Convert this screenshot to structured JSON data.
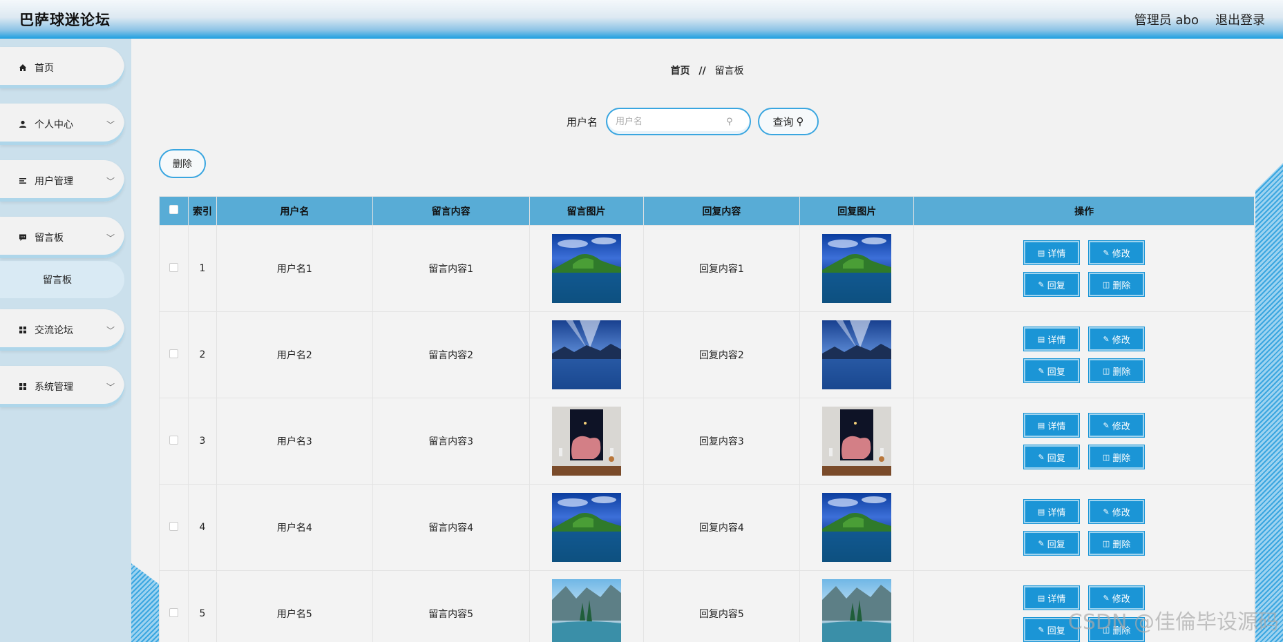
{
  "header": {
    "title": "巴萨球迷论坛",
    "user": "管理员 abo",
    "logout": "退出登录"
  },
  "sidebar": {
    "items": [
      {
        "label": "首页",
        "icon": "home-icon"
      },
      {
        "label": "个人中心",
        "icon": "user-icon"
      },
      {
        "label": "用户管理",
        "icon": "list-icon"
      },
      {
        "label": "留言板",
        "icon": "message-icon"
      },
      {
        "label": "交流论坛",
        "icon": "grid-icon"
      },
      {
        "label": "系统管理",
        "icon": "grid-icon"
      }
    ],
    "sub_item": "留言板"
  },
  "breadcrumb": {
    "home": "首页",
    "sep": "//",
    "current": "留言板"
  },
  "search": {
    "label": "用户名",
    "placeholder": "用户名",
    "button": "查询"
  },
  "toolbar": {
    "delete_label": "删除"
  },
  "table": {
    "headers": [
      "索引",
      "用户名",
      "留言内容",
      "留言图片",
      "回复内容",
      "回复图片",
      "操作"
    ],
    "rows": [
      {
        "index": "1",
        "username": "用户名1",
        "content": "留言内容1",
        "reply": "回复内容1",
        "image": "lake-island-image"
      },
      {
        "index": "2",
        "username": "用户名2",
        "content": "留言内容2",
        "reply": "回复内容2",
        "image": "mountain-lake-sky-image"
      },
      {
        "index": "3",
        "username": "用户名3",
        "content": "留言内容3",
        "reply": "回复内容3",
        "image": "framed-art-image"
      },
      {
        "index": "4",
        "username": "用户名4",
        "content": "留言内容4",
        "reply": "回复内容4",
        "image": "lake-island-image"
      },
      {
        "index": "5",
        "username": "用户名5",
        "content": "留言内容5",
        "reply": "回复内容5",
        "image": "river-valley-image"
      }
    ],
    "actions": {
      "detail": "详情",
      "edit": "修改",
      "reply": "回复",
      "delete": "删除"
    }
  },
  "watermark": "CSDN @佳倫毕设源码",
  "colors": {
    "accent": "#1b95d6",
    "header_bar": "#58acd6",
    "sidebar_bg": "#cbe0ec"
  }
}
